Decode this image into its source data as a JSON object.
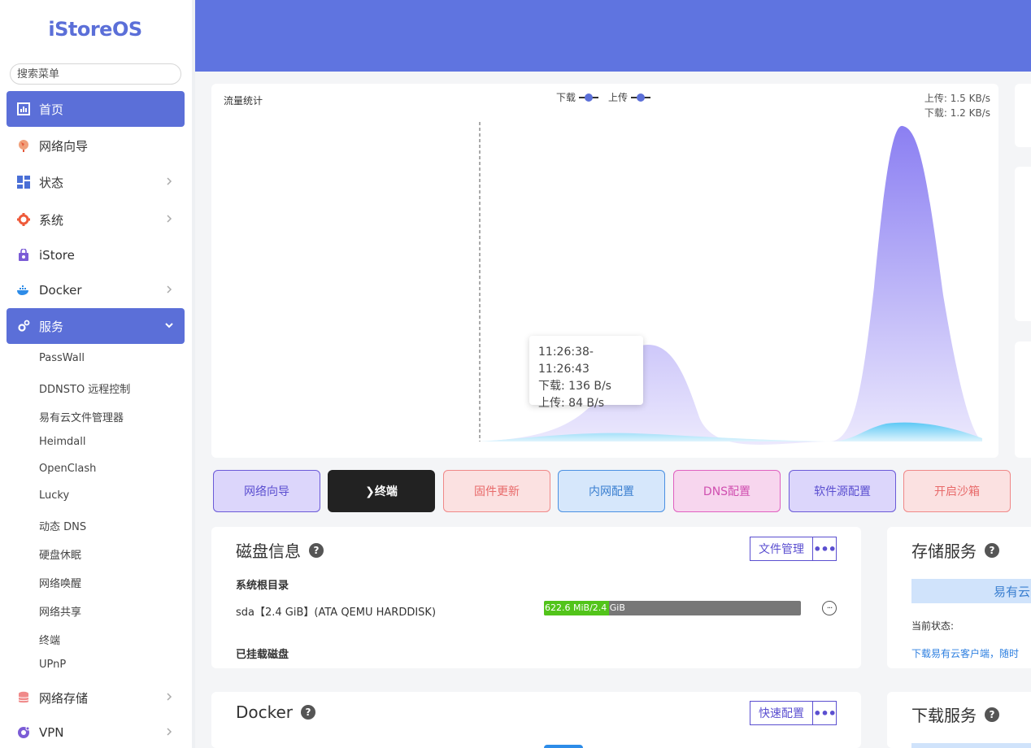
{
  "sidebar": {
    "logo": "iStoreOS",
    "search_placeholder": "搜索菜单",
    "items": [
      {
        "label": "首页",
        "icon": "dashboard-icon"
      },
      {
        "label": "网络向导",
        "icon": "globe-icon"
      },
      {
        "label": "状态",
        "icon": "grid-icon"
      },
      {
        "label": "系统",
        "icon": "gear-icon"
      },
      {
        "label": "iStore",
        "icon": "bag-icon"
      },
      {
        "label": "Docker",
        "icon": "docker-icon"
      },
      {
        "label": "服务",
        "icon": "gears-icon"
      },
      {
        "label": "网络存储",
        "icon": "database-icon"
      },
      {
        "label": "VPN",
        "icon": "vpn-icon"
      }
    ],
    "sub_items": [
      "PassWall",
      "DDNSTO 远程控制",
      "易有云文件管理器",
      "Heimdall",
      "OpenClash",
      "Lucky",
      "动态 DNS",
      "硬盘休眠",
      "网络唤醒",
      "网络共享",
      "终端",
      "UPnP"
    ]
  },
  "traffic": {
    "title": "流量统计",
    "legend_download": "下载",
    "legend_upload": "上传",
    "upload_rate": "上传: 1.5 KB/s",
    "download_rate": "下载: 1.2 KB/s",
    "tooltip": {
      "time": "11:26:38-11:26:43",
      "download": "下载: 136 B/s",
      "upload": "上传: 84 B/s"
    },
    "colors": {
      "download": "#8b7ff2",
      "upload": "#5cc8f5"
    }
  },
  "quick_buttons": [
    {
      "label": "网络向导"
    },
    {
      "label": "❯终端"
    },
    {
      "label": "固件更新"
    },
    {
      "label": "内网配置"
    },
    {
      "label": "DNS配置"
    },
    {
      "label": "软件源配置"
    },
    {
      "label": "开启沙箱"
    }
  ],
  "disk": {
    "title": "磁盘信息",
    "help": "?",
    "file_manage": "文件管理",
    "more": "•••",
    "root_label": "系统根目录",
    "disk_name": "sda【2.4 GiB】(ATA QEMU HARDDISK)",
    "usage_text": "622.6 MiB/2.4 GiB",
    "usage_fraction": 0.253,
    "more_circle": "···",
    "mounted_label": "已挂载磁盘"
  },
  "docker": {
    "title": "Docker",
    "help": "?",
    "quick_config": "快速配置",
    "more": "•••"
  },
  "storage": {
    "title": "存储服务",
    "help": "?",
    "service_name": "易有云",
    "status_label": "当前状态:",
    "download_link": "下载易有云客户端，随时"
  },
  "download_service": {
    "title": "下载服务",
    "help": "?"
  }
}
